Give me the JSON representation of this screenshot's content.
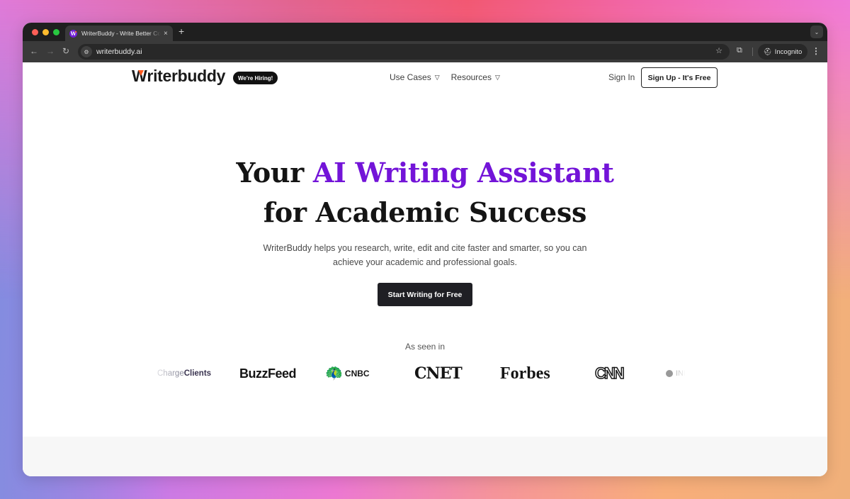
{
  "browser": {
    "tab_title": "WriterBuddy - Write Better Content",
    "favicon_letter": "W",
    "new_tab_symbol": "+",
    "close_symbol": "×",
    "url": "writerbuddy.ai",
    "incognito_label": "Incognito"
  },
  "header": {
    "logo_text": "riterbuddy",
    "logo_initial": "W",
    "hiring_badge": "We're Hiring!",
    "nav": [
      {
        "label": "Use Cases",
        "icon": "triangle-down-icon"
      },
      {
        "label": "Resources",
        "icon": "triangle-down-icon"
      }
    ],
    "sign_in": "Sign In",
    "sign_up": "Sign Up - It's Free"
  },
  "hero": {
    "title_pre": "Your ",
    "title_accent": "AI Writing Assistant",
    "title_line2": "for Academic Success",
    "subtitle_line1": "WriterBuddy helps you research, write, edit and cite faster and smarter, so you can",
    "subtitle_line2": "achieve your academic and professional goals.",
    "cta": "Start Writing for Free",
    "accent_color": "#7314d8"
  },
  "press": {
    "label": "As seen in",
    "logos": [
      {
        "name": "Charge Clients",
        "part1": "Charge ",
        "part2": "Clients"
      },
      {
        "name": "BuzzFeed",
        "text": "BuzzFeed"
      },
      {
        "name": "CNBC",
        "text": "CNBC"
      },
      {
        "name": "CNET",
        "text": "CNET"
      },
      {
        "name": "Forbes",
        "text": "Forbes"
      },
      {
        "name": "CNN",
        "text": "CNN"
      },
      {
        "name": "Inc",
        "text": "INI"
      }
    ]
  }
}
